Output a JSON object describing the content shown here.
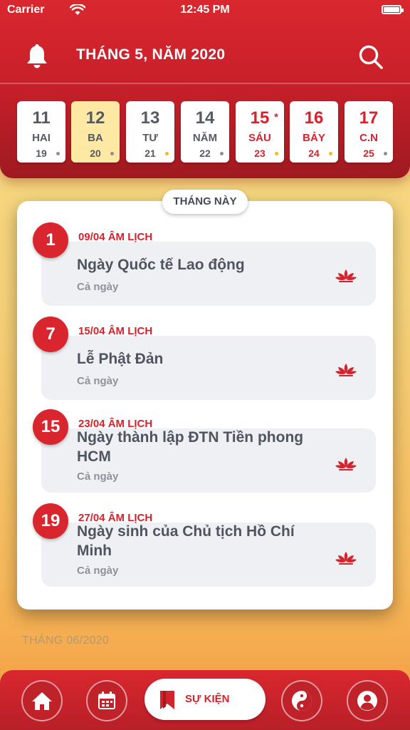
{
  "status": {
    "carrier": "Carrier",
    "time": "12:45 PM"
  },
  "header": {
    "title": "THÁNG 5, NĂM 2020"
  },
  "days": [
    {
      "num": "11",
      "name": "HAI",
      "lunar": "19",
      "dot": "gray"
    },
    {
      "num": "12",
      "name": "BA",
      "lunar": "20",
      "dot": "gray"
    },
    {
      "num": "13",
      "name": "TƯ",
      "lunar": "21",
      "dot": "yellow"
    },
    {
      "num": "14",
      "name": "NĂM",
      "lunar": "22",
      "dot": "gray"
    },
    {
      "num": "15",
      "name": "SÁU",
      "lunar": "23",
      "dot": "yellow",
      "star": "*"
    },
    {
      "num": "16",
      "name": "BẢY",
      "lunar": "24",
      "dot": "yellow"
    },
    {
      "num": "17",
      "name": "C.N",
      "lunar": "25",
      "dot": "gray"
    }
  ],
  "section_label": "THÁNG NÀY",
  "events": [
    {
      "day": "1",
      "lunar": "09/04 ÂM LỊCH",
      "title": "Ngày Quốc tế Lao động",
      "sub": "Cả ngày"
    },
    {
      "day": "7",
      "lunar": "15/04 ÂM LỊCH",
      "title": "Lễ Phật Đản",
      "sub": "Cả ngày"
    },
    {
      "day": "15",
      "lunar": "23/04 ÂM LỊCH",
      "title": "Ngày thành lập ĐTN Tiền phong HCM",
      "sub": "Cả ngày"
    },
    {
      "day": "19",
      "lunar": "27/04 ÂM LỊCH",
      "title": "Ngày sinh của Chủ tịch Hồ Chí Minh",
      "sub": "Cả ngày"
    }
  ],
  "next_month": "THÁNG 06/2020",
  "tabbar": {
    "active_label": "SỰ KIỆN"
  },
  "colors": {
    "primary": "#d3232c",
    "selected_day": "#fde8a4",
    "accent_dot": "#f2b928"
  }
}
